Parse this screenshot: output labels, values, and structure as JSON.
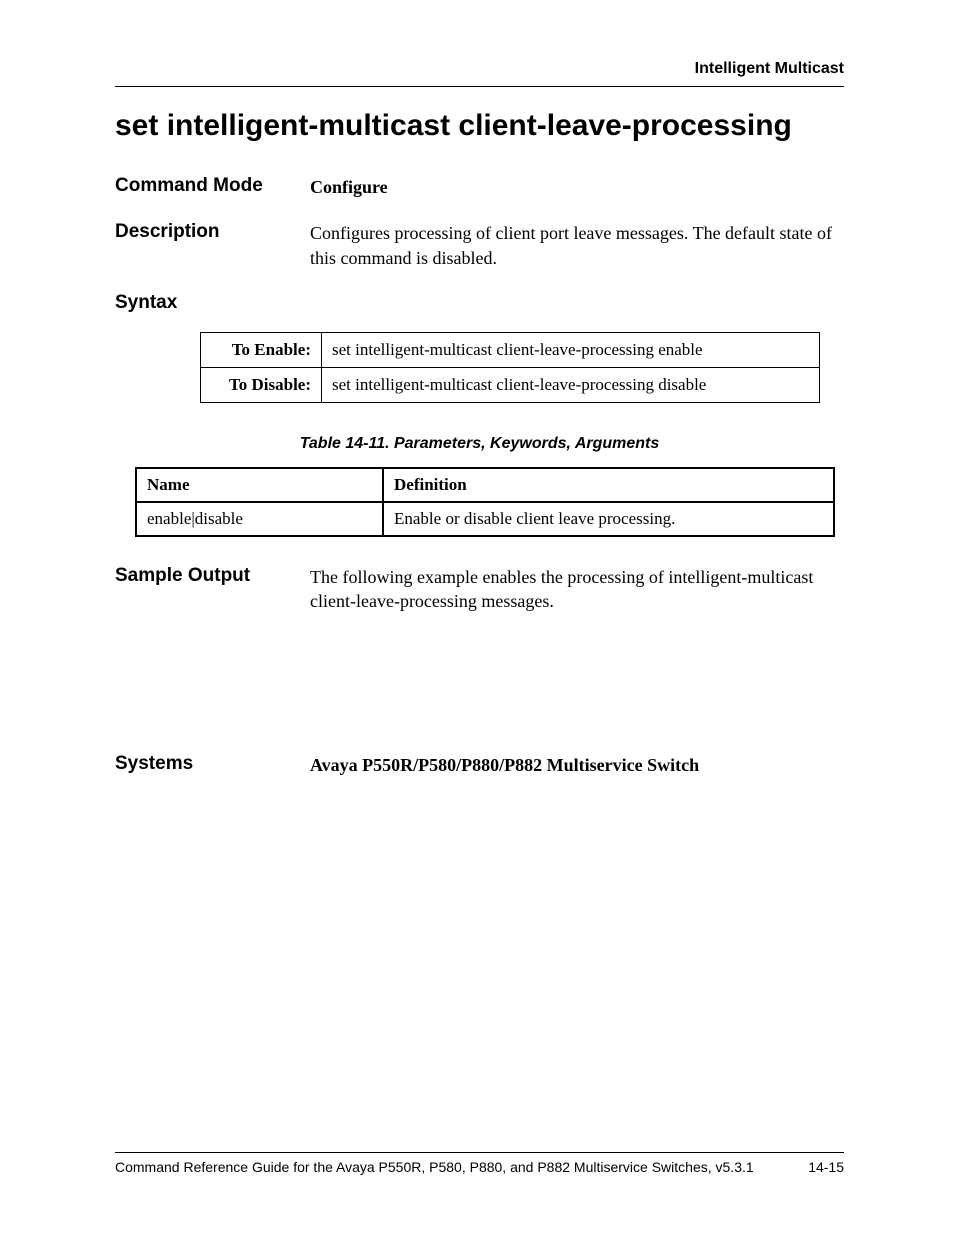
{
  "header": {
    "running": "Intelligent Multicast"
  },
  "title": "set intelligent-multicast client-leave-processing",
  "commandMode": {
    "label": "Command Mode",
    "value": "Configure"
  },
  "description": {
    "label": "Description",
    "value": "Configures processing of client port leave messages. The default state of this command is disabled."
  },
  "syntax": {
    "label": "Syntax",
    "rows": [
      {
        "label": "To Enable:",
        "cmd": "set intelligent-multicast client-leave-processing enable"
      },
      {
        "label": "To Disable:",
        "cmd": "set intelligent-multicast client-leave-processing disable"
      }
    ]
  },
  "paramTable": {
    "caption": "Table 14-11.  Parameters, Keywords, Arguments",
    "headers": {
      "name": "Name",
      "definition": "Definition"
    },
    "rows": [
      {
        "name": "enable|disable",
        "definition": "Enable or disable client leave processing."
      }
    ]
  },
  "sampleOutput": {
    "label": "Sample Output",
    "value": "The following example enables the processing of intelligent-multicast client-leave-processing messages."
  },
  "systems": {
    "label": "Systems",
    "value": "Avaya P550R/P580/P880/P882 Multiservice Switch"
  },
  "footer": {
    "left": "Command Reference Guide for the Avaya P550R, P580, P880, and P882 Multiservice Switches, v5.3.1",
    "right": "14-15"
  }
}
